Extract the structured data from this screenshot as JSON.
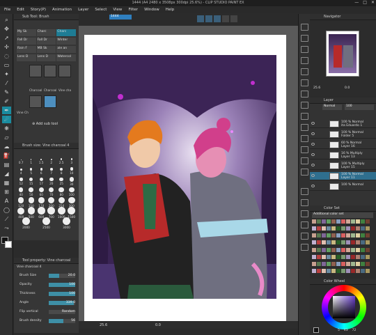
{
  "window": {
    "title": "1444 (A4 2480 x 3508px 300dpi 25.6%) - CLIP STUDIO PAINT EX",
    "controls": [
      "—",
      "□",
      "✕"
    ]
  },
  "menu": [
    "File",
    "Edit",
    "Story(P)",
    "Animation",
    "Layer",
    "Select",
    "View",
    "Filter",
    "Window",
    "Help"
  ],
  "subtool": {
    "header": "Sub Tool: Brush",
    "tabs_row1": [
      "My Sk",
      "Charc",
      "Charc"
    ],
    "tabs_row2": [
      "Fall Dr",
      "Fall Dr",
      "Winter"
    ],
    "tabs_row3": [
      "Rain F",
      "MB Sk",
      "ale an"
    ],
    "tabs_row4": [
      "Lens D",
      "Lens D",
      "Watercol"
    ],
    "brush_labels": [
      "Charcoal",
      "Charcoal",
      "Vine cha"
    ],
    "selected_brush": "Vine Ch",
    "add_label": "Add sub tool"
  },
  "brush_size": {
    "header": "Brush size: Vine charcoal 4",
    "sizes": [
      [
        "0.7",
        "1",
        "1.5",
        "2",
        "2.5",
        "3"
      ],
      [
        "4",
        "5",
        "6",
        "7",
        "8",
        "10"
      ],
      [
        "12",
        "15",
        "17",
        "20",
        "25",
        "30"
      ],
      [
        "40",
        "50",
        "60",
        "70",
        "80",
        "100"
      ],
      [
        "120",
        "150",
        "170",
        "200",
        "250",
        "300"
      ],
      [
        "400",
        "500",
        "600",
        "700",
        "1000",
        "1500"
      ],
      [
        "2000",
        "2500",
        "3000"
      ]
    ]
  },
  "tool_property": {
    "header": "Tool property: Vine charcoal",
    "subheader": "Vine charcoal 4",
    "rows": [
      {
        "label": "Brush Size",
        "value": "20.0",
        "fill": 0.4
      },
      {
        "label": "Opacity",
        "value": "100",
        "fill": 1.0
      },
      {
        "label": "Thickness",
        "value": "100",
        "fill": 1.0
      },
      {
        "label": "Angle",
        "value": "339.0",
        "fill": 0.94
      },
      {
        "label": "Flip vertical",
        "value": "Random",
        "fill": 0
      },
      {
        "label": "Brush density",
        "value": "56",
        "fill": 0.56
      }
    ]
  },
  "canvas": {
    "tab_label": "1444",
    "zoom": "25.6",
    "rotation": "0.0"
  },
  "navigator": {
    "header": "Navigator",
    "zoom": "25.6",
    "rotation": "0.0"
  },
  "layers": {
    "header": "Layer",
    "blend": "Normal",
    "opacity": "100",
    "rows": [
      {
        "pct": "100 % Normal",
        "name": "ita Eduardo 1",
        "sel": false
      },
      {
        "pct": "100 % Normal",
        "name": "Folder 5",
        "sel": false
      },
      {
        "pct": "60 % Normal",
        "name": "Layer 16",
        "sel": false
      },
      {
        "pct": "16 % Multiply",
        "name": "Layer 13",
        "sel": false
      },
      {
        "pct": "100 % Multiply",
        "name": "Layer 15",
        "sel": false
      },
      {
        "pct": "100 % Normal",
        "name": "Layer 11",
        "sel": true
      },
      {
        "pct": "100 % Normal",
        "name": "",
        "sel": false
      }
    ]
  },
  "colorset": {
    "header": "Color Set",
    "set_name": "Additional color set"
  },
  "colorwheel": {
    "header": "Color Wheel",
    "h": "5",
    "s": "43",
    "v": "72"
  },
  "colors": {
    "accent": "#1e7c94",
    "selection": "#2f6f8f",
    "canvas_bg": "#5a5a5a",
    "panel": "#363636"
  }
}
